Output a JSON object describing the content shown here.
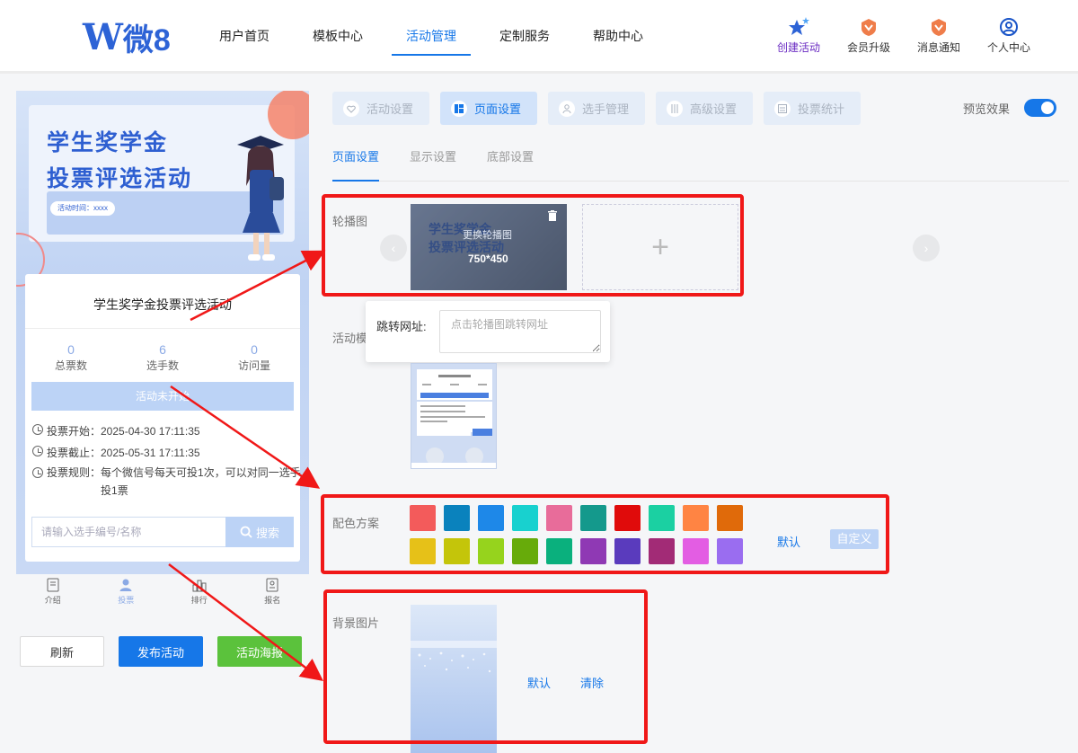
{
  "logo": {
    "letter": "W",
    "text": "微8"
  },
  "nav": {
    "items": [
      {
        "label": "用户首页"
      },
      {
        "label": "模板中心"
      },
      {
        "label": "活动管理"
      },
      {
        "label": "定制服务"
      },
      {
        "label": "帮助中心"
      }
    ],
    "active": "活动管理"
  },
  "tools": {
    "create": "创建活动",
    "upgrade": "会员升级",
    "notice": "消息通知",
    "profile": "个人中心"
  },
  "preview": {
    "banner": {
      "line1": "学生奖学金",
      "line2": "投票评选活动",
      "date_pill": "活动时间：xxxx"
    },
    "title": "学生奖学金投票评选活动",
    "stats": [
      {
        "value": "0",
        "label": "总票数"
      },
      {
        "value": "6",
        "label": "选手数"
      },
      {
        "value": "0",
        "label": "访问量"
      }
    ],
    "status": "活动未开始",
    "vote_start": "投票开始：2025-04-30 17:11:35",
    "vote_end": "投票截止：2025-05-31 17:11:35",
    "rule_label": "投票规则：",
    "rule_text": "每个微信号每天可投1次，可以对同一选手投1票",
    "search_placeholder": "请输入选手编号/名称",
    "search_button": "搜索",
    "bottom_nav": [
      "介绍",
      "投票",
      "排行",
      "报名"
    ]
  },
  "actions": {
    "refresh": "刷新",
    "publish": "发布活动",
    "poster": "活动海报"
  },
  "config": {
    "tabs": [
      "活动设置",
      "页面设置",
      "选手管理",
      "高级设置",
      "投票统计"
    ],
    "active_tab": "页面设置",
    "preview_toggle": "预览效果",
    "subtabs": [
      "页面设置",
      "显示设置",
      "底部设置"
    ],
    "carousel_label": "轮播图",
    "carousel_replace": "更换轮播图",
    "carousel_size": "750*450",
    "carousel_thumb_line1": "学生奖学金",
    "carousel_thumb_line2": "投票评选活动",
    "jump_label": "跳转网址:",
    "jump_placeholder": "点击轮播图跳转网址",
    "template_label": "活动模",
    "color_label": "配色方案",
    "colors": [
      "#f35b5b",
      "#0a82bd",
      "#1e88e8",
      "#18d1cf",
      "#e86c9a",
      "#14998c",
      "#e00b0b",
      "#1bd0a2",
      "#ff8443",
      "#e06a0a",
      "#e6c118",
      "#c4c50a",
      "#96d31d",
      "#67ab0a",
      "#0ab07d",
      "#8f39b4",
      "#5a3bbd",
      "#a22b76",
      "#e35de3",
      "#9a6df0"
    ],
    "color_default": "默认",
    "color_custom": "自定义",
    "bg_label": "背景图片",
    "bg_default": "默认",
    "bg_clear": "清除"
  }
}
